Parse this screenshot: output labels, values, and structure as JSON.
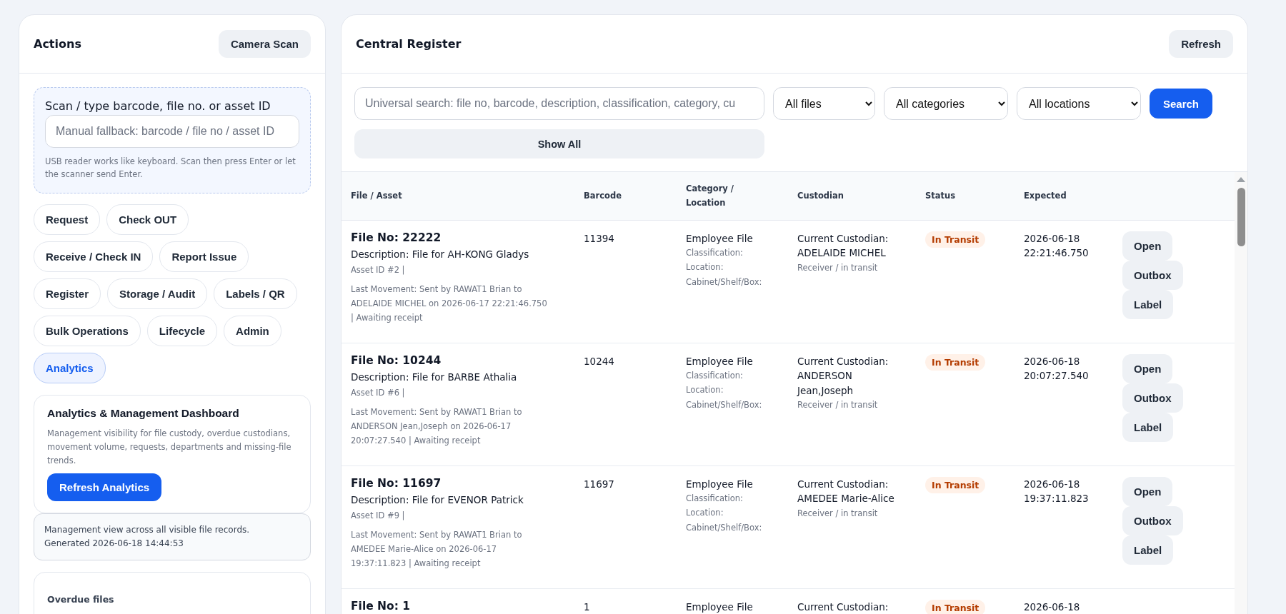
{
  "actions_panel": {
    "title": "Actions",
    "camera_button": "Camera Scan",
    "scanner": {
      "label": "Scan / type barcode, file no. or asset ID",
      "placeholder": "Manual fallback: barcode / file no / asset ID",
      "hint": "USB reader works like keyboard. Scan then press Enter or let the scanner send Enter."
    },
    "action_chips": [
      {
        "label": "Request",
        "selected": false
      },
      {
        "label": "Check OUT",
        "selected": false
      },
      {
        "label": "Receive / Check IN",
        "selected": false
      },
      {
        "label": "Report Issue",
        "selected": false
      },
      {
        "label": "Register",
        "selected": false
      },
      {
        "label": "Storage / Audit",
        "selected": false
      },
      {
        "label": "Labels / QR",
        "selected": false
      },
      {
        "label": "Bulk Operations",
        "selected": false
      },
      {
        "label": "Lifecycle",
        "selected": false
      },
      {
        "label": "Admin",
        "selected": false
      },
      {
        "label": "Analytics",
        "selected": true
      }
    ],
    "dashboard": {
      "title": "Analytics & Management Dashboard",
      "description": "Management visibility for file custody, overdue custodians, movement volume, requests, departments and missing-file trends.",
      "button": "Refresh Analytics"
    },
    "info_note": [
      "Management view across all visible file records.",
      "Generated 2026-06-18 14:44:53"
    ],
    "overdue_card": {
      "title": "Overdue files"
    }
  },
  "register_panel": {
    "title": "Central Register",
    "refresh_button": "Refresh",
    "search": {
      "placeholder": "Universal search: file no, barcode, description, classification, category, cu"
    },
    "filters": [
      "All files",
      "All categories",
      "All locations"
    ],
    "search_button": "Search",
    "show_all_button": "Show All",
    "table": {
      "columns": [
        "File / Asset",
        "Barcode",
        "Category / Location",
        "Custodian",
        "Status",
        "Expected"
      ],
      "rows": [
        {
          "file_no": "File No: 22222",
          "description": "Description: File for AH-KONG Gladys",
          "asset_id": "Asset ID #2 |",
          "last_movement": "Last Movement: Sent by RAWAT1 Brian to ADELAIDE MICHEL on 2026-06-17 22:21:46.750 | Awaiting receipt",
          "barcode": "11394",
          "category": "Employee File",
          "classification": "Classification:",
          "location": "Location:",
          "cabinet": "Cabinet/Shelf/Box:",
          "custodian_label": "Current Custodian:",
          "custodian": "ADELAIDE MICHEL",
          "custodian_role": "Receiver / in transit",
          "status": "In Transit",
          "expected": [
            "2026-06-18",
            "22:21:46.750"
          ],
          "buttons": [
            "Open",
            "Outbox",
            "Label"
          ]
        },
        {
          "file_no": "File No: 10244",
          "description": "Description: File for BARBE Athalia",
          "asset_id": "Asset ID #6 |",
          "last_movement": "Last Movement: Sent by RAWAT1 Brian to ANDERSON Jean,Joseph on 2026-06-17 20:07:27.540 | Awaiting receipt",
          "barcode": "10244",
          "category": "Employee File",
          "classification": "Classification:",
          "location": "Location:",
          "cabinet": "Cabinet/Shelf/Box:",
          "custodian_label": "Current Custodian:",
          "custodian": "ANDERSON Jean,Joseph",
          "custodian_role": "Receiver / in transit",
          "status": "In Transit",
          "expected": [
            "2026-06-18",
            "20:07:27.540"
          ],
          "buttons": [
            "Open",
            "Outbox",
            "Label"
          ]
        },
        {
          "file_no": "File No: 11697",
          "description": "Description: File for EVENOR Patrick",
          "asset_id": "Asset ID #9 |",
          "last_movement": "Last Movement: Sent by RAWAT1 Brian to AMEDEE Marie-Alice on 2026-06-17 19:37:11.823 | Awaiting receipt",
          "barcode": "11697",
          "category": "Employee File",
          "classification": "Classification:",
          "location": "Location:",
          "cabinet": "Cabinet/Shelf/Box:",
          "custodian_label": "Current Custodian:",
          "custodian": "AMEDEE Marie-Alice",
          "custodian_role": "Receiver / in transit",
          "status": "In Transit",
          "expected": [
            "2026-06-18",
            "19:37:11.823"
          ],
          "buttons": [
            "Open",
            "Outbox",
            "Label"
          ]
        },
        {
          "file_no": "File No: 1",
          "barcode": "1",
          "category": "Employee File",
          "custodian_label": "Current Custodian:",
          "status": "In Transit",
          "expected": [
            "2026-06-18"
          ]
        }
      ]
    }
  }
}
